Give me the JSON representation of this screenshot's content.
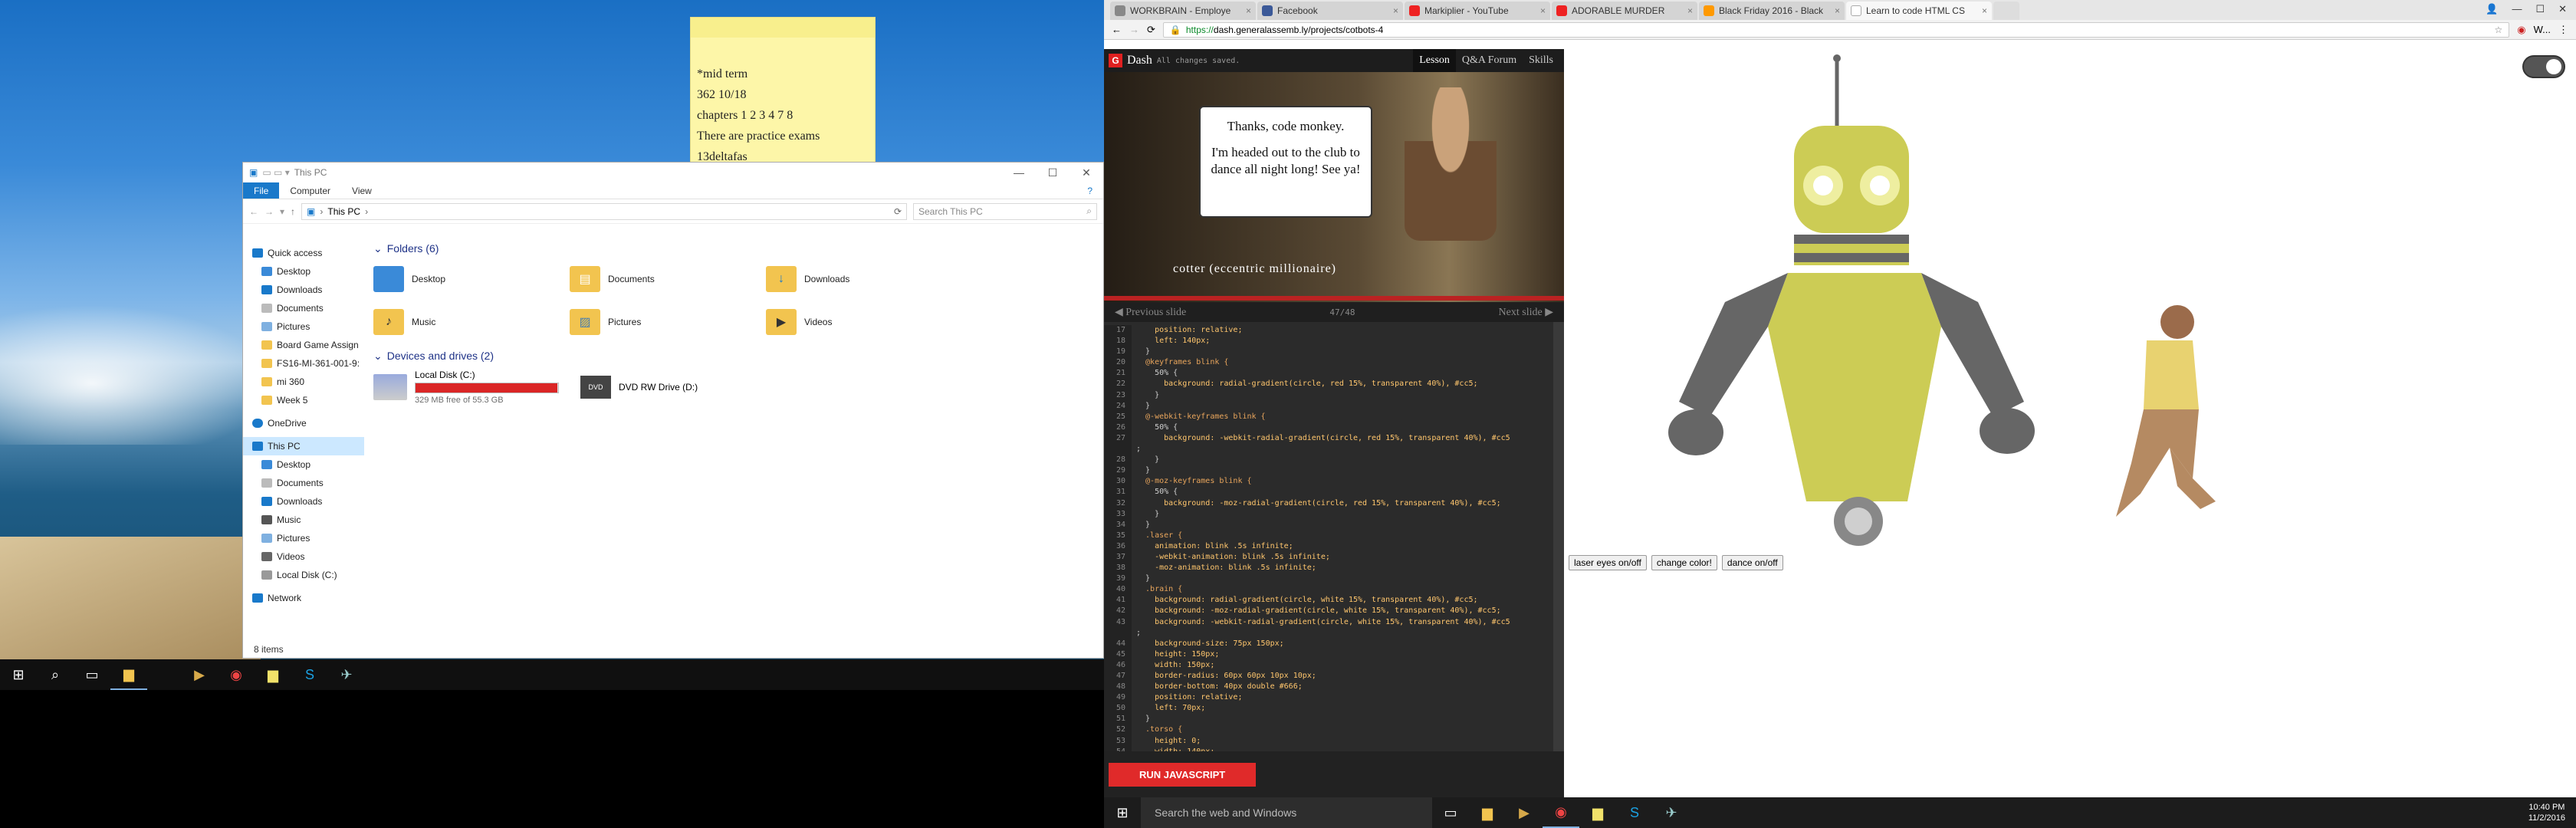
{
  "sticky_note": {
    "lines": [
      "*mid term",
      "362 10/18",
      "chapters 1 2 3 4 7 8",
      "There are practice exams",
      "13deltafas"
    ]
  },
  "explorer": {
    "title": "This PC",
    "ribbon": [
      "File",
      "Computer",
      "View"
    ],
    "address": "This PC",
    "search_placeholder": "Search This PC",
    "nav_items": [
      "Quick access",
      "Desktop",
      "Downloads",
      "Documents",
      "Pictures",
      "Board Game Assign",
      "FS16-MI-361-001-9:",
      "mi 360",
      "Week 5",
      "OneDrive",
      "This PC",
      "Desktop",
      "Documents",
      "Downloads",
      "Music",
      "Pictures",
      "Videos",
      "Local Disk (C:)",
      "Network"
    ],
    "folders_header": "Folders (6)",
    "folders": [
      "Desktop",
      "Documents",
      "Downloads",
      "Music",
      "Pictures",
      "Videos"
    ],
    "drives_header": "Devices and drives (2)",
    "drive_c": {
      "name": "Local Disk (C:)",
      "free": "329 MB free of 55.3 GB",
      "used_fraction": 0.994
    },
    "drive_dvd": "DVD RW Drive (D:)",
    "status": "8 items"
  },
  "browser": {
    "tabs": [
      "WORKBRAIN - Employe",
      "Facebook",
      "Markiplier - YouTube",
      "ADORABLE MURDER",
      "Black Friday 2016 - Black",
      "Learn to code HTML CS"
    ],
    "url_secure": "https://",
    "url_rest": "dash.generalassemb.ly/projects/cotbots-4",
    "profile": "W..."
  },
  "dash": {
    "brand": "Dash",
    "saved": "All changes saved.",
    "nav": [
      "Lesson",
      "Q&A Forum",
      "Skills"
    ],
    "bubble_1": "Thanks, code monkey.",
    "bubble_2": "I'm headed out to the club to dance all night long! See ya!",
    "caption": "cotter (eccentric millionaire)",
    "prev": "Previous slide",
    "next": "Next slide",
    "progress": "47/48",
    "run": "RUN JAVASCRIPT"
  },
  "code": [
    [
      "17",
      "    position: relative;"
    ],
    [
      "18",
      "    left: 140px;"
    ],
    [
      "19",
      "  }"
    ],
    [
      "20",
      "  @keyframes blink {"
    ],
    [
      "21",
      "    50% {"
    ],
    [
      "22",
      "      background: radial-gradient(circle, red 15%, transparent 40%), #cc5;"
    ],
    [
      "23",
      "    }"
    ],
    [
      "24",
      "  }"
    ],
    [
      "25",
      "  @-webkit-keyframes blink {"
    ],
    [
      "26",
      "    50% {"
    ],
    [
      "27",
      "      background: -webkit-radial-gradient(circle, red 15%, transparent 40%), #cc5"
    ],
    [
      "",
      ";"
    ],
    [
      "28",
      "    }"
    ],
    [
      "29",
      "  }"
    ],
    [
      "30",
      "  @-moz-keyframes blink {"
    ],
    [
      "31",
      "    50% {"
    ],
    [
      "32",
      "      background: -moz-radial-gradient(circle, red 15%, transparent 40%), #cc5;"
    ],
    [
      "33",
      "    }"
    ],
    [
      "34",
      "  }"
    ],
    [
      "35",
      "  .laser {"
    ],
    [
      "36",
      "    animation: blink .5s infinite;"
    ],
    [
      "37",
      "    -webkit-animation: blink .5s infinite;"
    ],
    [
      "38",
      "    -moz-animation: blink .5s infinite;"
    ],
    [
      "39",
      "  }"
    ],
    [
      "40",
      "  .brain {"
    ],
    [
      "41",
      "    background: radial-gradient(circle, white 15%, transparent 40%), #cc5;"
    ],
    [
      "42",
      "    background: -moz-radial-gradient(circle, white 15%, transparent 40%), #cc5;"
    ],
    [
      "43",
      "    background: -webkit-radial-gradient(circle, white 15%, transparent 40%), #cc5"
    ],
    [
      "",
      ";"
    ],
    [
      "44",
      "    background-size: 75px 150px;"
    ],
    [
      "45",
      "    height: 150px;"
    ],
    [
      "46",
      "    width: 150px;"
    ],
    [
      "47",
      "    border-radius: 60px 60px 10px 10px;"
    ],
    [
      "48",
      "    border-bottom: 40px double #666;"
    ],
    [
      "49",
      "    position: relative;"
    ],
    [
      "50",
      "    left: 70px;"
    ],
    [
      "51",
      "  }"
    ],
    [
      "52",
      "  .torso {"
    ],
    [
      "53",
      "    height: 0;"
    ],
    [
      "54",
      "    width: 140px;"
    ]
  ],
  "robot_buttons": [
    "laser eyes on/off",
    "change color!",
    "dance on/off"
  ],
  "taskbar": {
    "search_placeholder": "Search the web and Windows",
    "time": "10:40 PM",
    "date": "11/2/2016"
  },
  "colors": {
    "robot_head": "#cccc55",
    "robot_gray": "#666666",
    "run_red": "#e02a2a",
    "drive_bar_red": "#da2626"
  }
}
